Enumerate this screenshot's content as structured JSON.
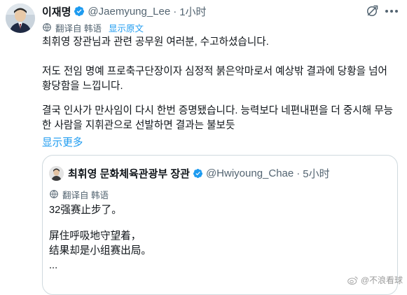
{
  "author": {
    "display_name": "이재명",
    "handle": "@Jaemyung_Lee",
    "time": "1小时"
  },
  "translation": {
    "label": "翻译自 韩语",
    "show_original": "显示原文"
  },
  "tweet": {
    "paragraph_1": "최휘영 장관님과 관련 공무원 여러분, 수고하셨습니다.",
    "paragraph_2": "저도 전임 명예 프로축구단장이자 심정적 붉은악마로서 예상밖 결과에 당황을 넘어 황당함을 느낍니다.",
    "paragraph_3": "결국 인사가 만사임이 다시 한번 증명됐습니다. 능력보다 네편내편을 더 중시해 무능한 사람을 지휘관으로 선발하면 결과는 불보듯",
    "show_more": "显示更多"
  },
  "quoted_tweet": {
    "display_name": "최휘영 문화체육관광부 장관",
    "handle": "@Hwiyoung_Chae",
    "separator": "·",
    "time": "5小时",
    "translation_label": "翻译自 韩语",
    "lines": [
      "32强赛止步了。",
      "",
      "屏住呼吸地守望着，",
      "结果却是小组赛出局。",
      "..."
    ]
  },
  "watermark": {
    "text": "@不浪看球"
  },
  "colors": {
    "accent": "#1d9bf0",
    "text": "#0f1419",
    "secondary_text": "#536471",
    "border": "#cfd9de"
  },
  "icons": {
    "verified": "verified-badge-icon",
    "grok": "grok-icon",
    "more": "more-options-icon",
    "translate": "globe-icon",
    "watermark": "weibo-logo-icon"
  }
}
